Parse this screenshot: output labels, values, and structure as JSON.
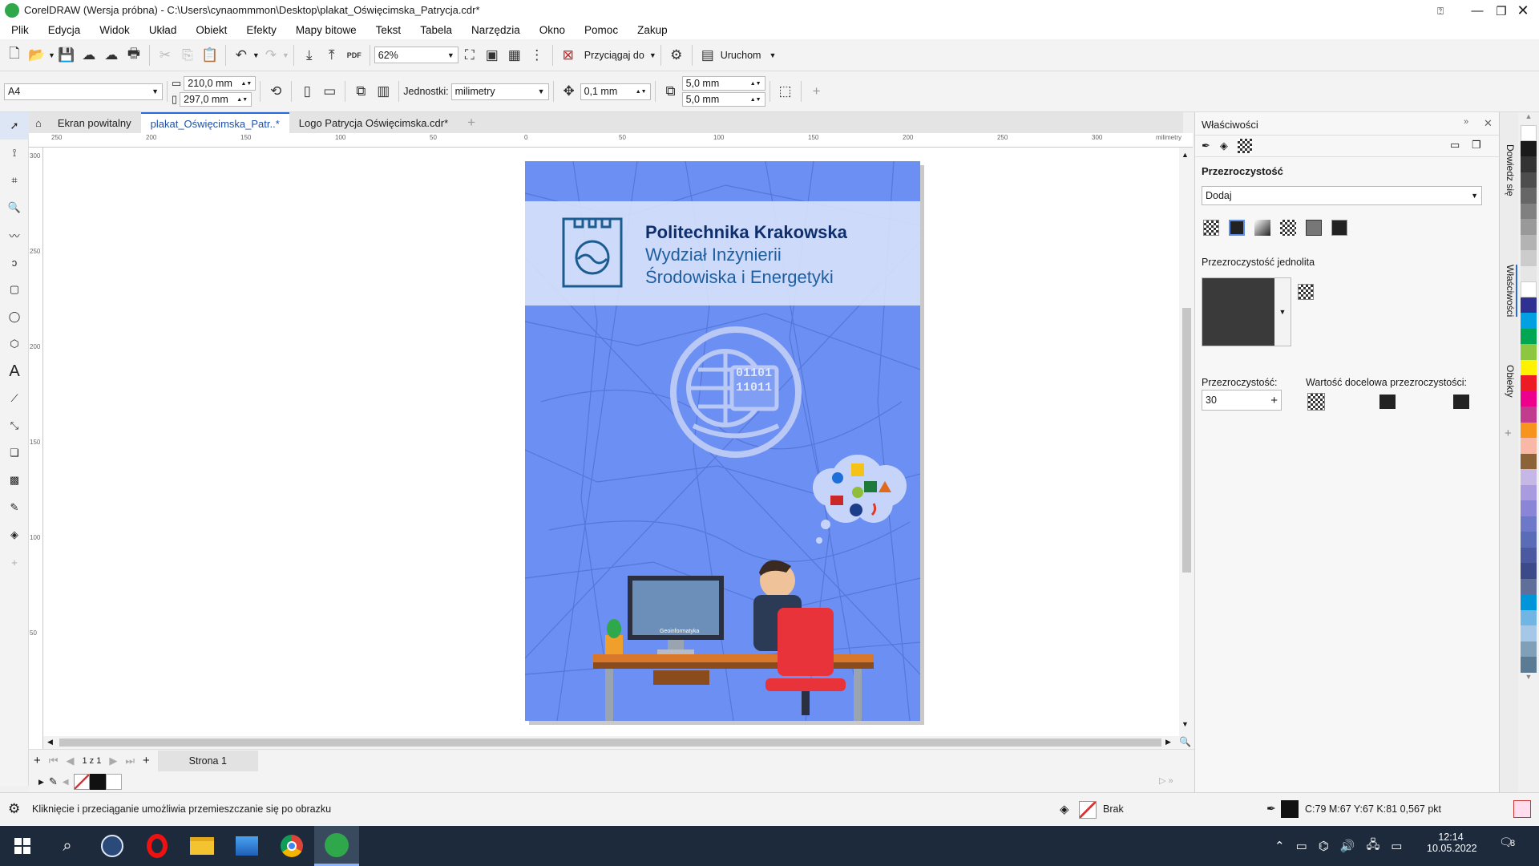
{
  "window": {
    "title": "CorelDRAW (Wersja próbna) - C:\\Users\\cynaommmon\\Desktop\\plakat_Oświęcimska_Patrycja.cdr*"
  },
  "menu": [
    "Plik",
    "Edycja",
    "Widok",
    "Układ",
    "Obiekt",
    "Efekty",
    "Mapy bitowe",
    "Tekst",
    "Tabela",
    "Narzędzia",
    "Okno",
    "Pomoc",
    "Zakup"
  ],
  "toolbar": {
    "zoom": "62%",
    "snap_label": "Przyciągaj do",
    "launch_label": "Uruchom",
    "pdf_label": "PDF"
  },
  "propbar": {
    "page_size": "A4",
    "width": "210,0 mm",
    "height": "297,0 mm",
    "units_label": "Jednostki:",
    "units_value": "milimetry",
    "nudge": "0,1 mm",
    "dup_x": "5,0 mm",
    "dup_y": "5,0 mm"
  },
  "tabs": [
    "Ekran powitalny",
    "plakat_Oświęcimska_Patr..*",
    "Logo Patrycja Oświęcimska.cdr*"
  ],
  "ruler": {
    "h": [
      "250",
      "200",
      "150",
      "100",
      "50",
      "0",
      "50",
      "100",
      "150",
      "200",
      "250",
      "300"
    ],
    "unit": "milimetry",
    "v": [
      "300",
      "250",
      "200",
      "150",
      "100",
      "50"
    ]
  },
  "poster": {
    "line1": "Politechnika Krakowska",
    "line2": "Wydział Inżynierii",
    "line3": "Środowiska i Energetyki",
    "binary1": "01101",
    "binary2": "11011",
    "screen_label": "Geoinformatyka"
  },
  "pagenav": {
    "counter": "1 z 1",
    "page_tab": "Strona 1"
  },
  "props": {
    "title": "Właściwości",
    "section": "Przezroczystość",
    "mode": "Dodaj",
    "uniform_label": "Przezroczystość jednolita",
    "transparency_label": "Przezroczystość:",
    "transparency_value": "30",
    "target_label": "Wartość docelowa przezroczystości:"
  },
  "sidetabs": [
    "Dowiedz się",
    "Właściwości",
    "Obiekty"
  ],
  "palette": [
    "#ffffff",
    "#1a1a1a",
    "#333333",
    "#4d4d4d",
    "#666666",
    "#808080",
    "#999999",
    "#b3b3b3",
    "#cccccc",
    "#e6e6e6",
    "#ffffff",
    "#2e3192",
    "#00a0e3",
    "#00a651",
    "#8dc63f",
    "#fff200",
    "#ed1c24",
    "#ec008c",
    "#c13c8e",
    "#f7941d",
    "#f9b8a6",
    "#8c6239",
    "#c6b8e6",
    "#a99be0",
    "#8a85d6",
    "#6e78c8",
    "#5a6cb8",
    "#4b5aa0",
    "#3d4a8a",
    "#5f6f99",
    "#0095d9",
    "#71b5e4",
    "#a6c8e8",
    "#7fa0b8",
    "#5b7b94"
  ],
  "status": {
    "hint": "Kliknięcie i przeciąganie umożliwia przemieszczanie się po obrazku",
    "fill": "Brak",
    "outline": "C:79 M:67 Y:67 K:81  0,567 pkt"
  },
  "taskbar": {
    "time": "12:14",
    "date": "10.05.2022",
    "notifications": "8"
  }
}
